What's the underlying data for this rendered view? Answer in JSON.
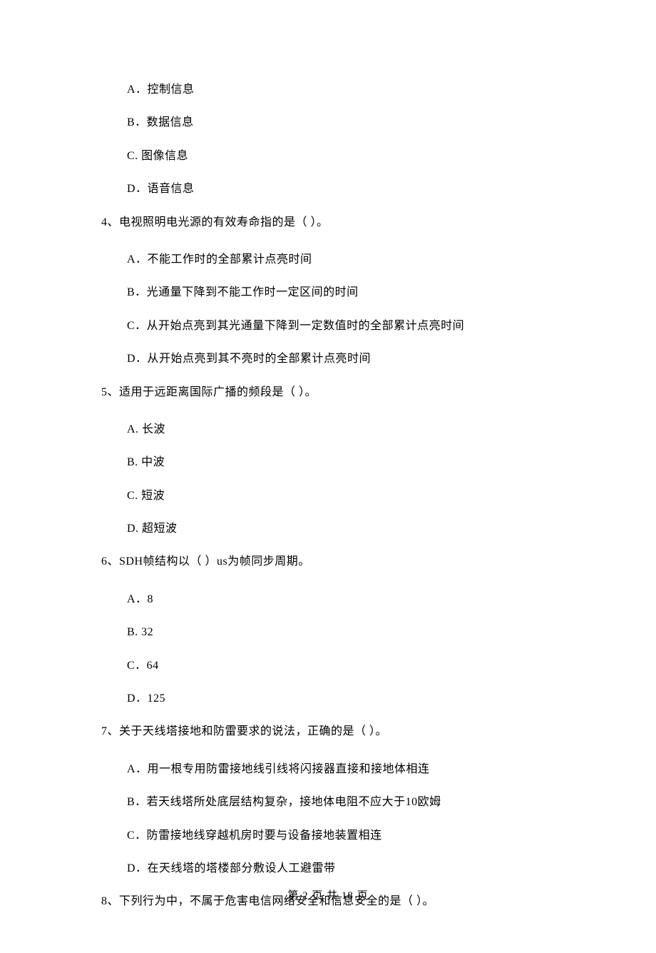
{
  "options_top": [
    "A．控制信息",
    "B．数据信息",
    "C. 图像信息",
    "D．语音信息"
  ],
  "q4": {
    "text": "4、电视照明电光源的有效寿命指的是（    ）。",
    "options": [
      "A．不能工作时的全部累计点亮时间",
      "B．光通量下降到不能工作时一定区间的时间",
      "C．从开始点亮到其光通量下降到一定数值时的全部累计点亮时间",
      "D．从开始点亮到其不亮时的全部累计点亮时间"
    ]
  },
  "q5": {
    "text": "5、适用于远距离国际广播的频段是（    ）。",
    "options": [
      "A. 长波",
      "B. 中波",
      "C. 短波",
      "D. 超短波"
    ]
  },
  "q6": {
    "text": "6、SDH帧结构以（    ）us为帧同步周期。",
    "options": [
      "A．8",
      "B. 32",
      "C．64",
      "D．125"
    ]
  },
  "q7": {
    "text": "7、关于天线塔接地和防雷要求的说法，正确的是（    ）。",
    "options": [
      "A．用一根专用防雷接地线引线将闪接器直接和接地体相连",
      "B．若天线塔所处底层结构复杂，接地体电阻不应大于10欧姆",
      "C．防雷接地线穿越机房时要与设备接地装置相连",
      "D．在天线塔的塔楼部分敷设人工避雷带"
    ]
  },
  "q8": {
    "text": "8、下列行为中，不属于危害电信网络安全和信息安全的是（    ）。"
  },
  "footer": "第 2 页 共 18 页"
}
